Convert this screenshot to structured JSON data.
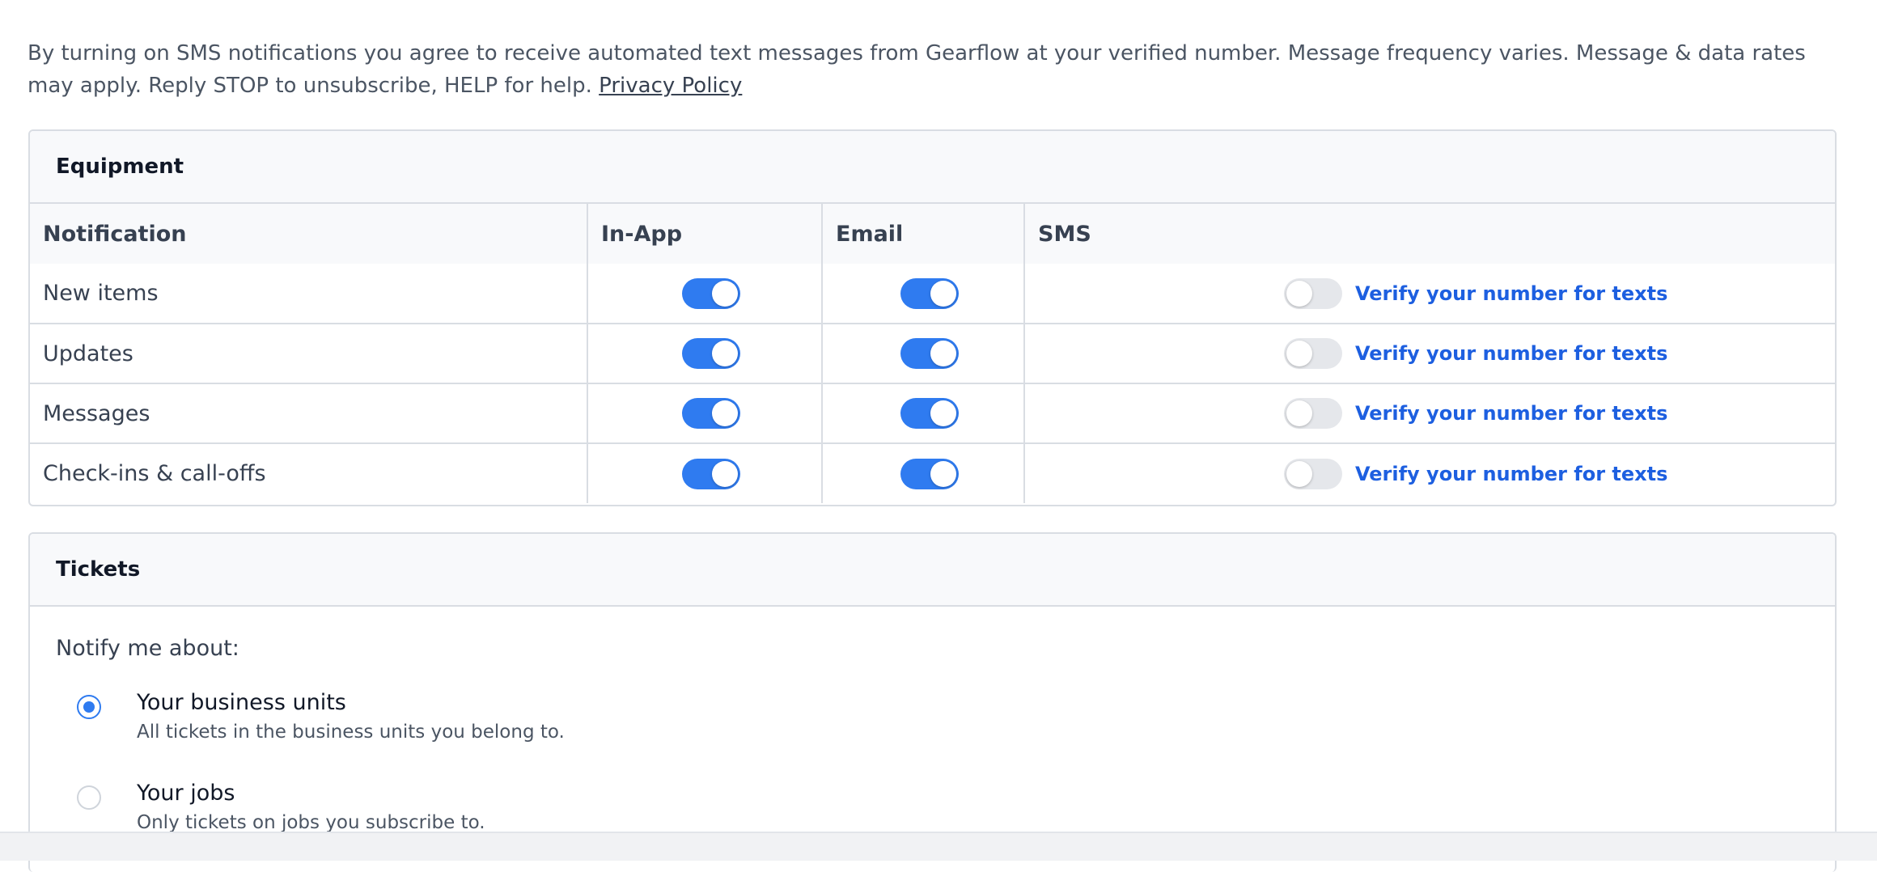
{
  "disclaimer": {
    "text": "By turning on SMS notifications you agree to receive automated text messages from Gearflow at your verified number. Message frequency varies. Message & data rates may apply. Reply STOP to unsubscribe, HELP for help.",
    "privacy_link": "Privacy Policy"
  },
  "equipment": {
    "title": "Equipment",
    "columns": [
      "Notification",
      "In-App",
      "Email",
      "SMS"
    ],
    "rows": [
      {
        "label": "New items",
        "in_app": true,
        "email": true,
        "sms": false,
        "sms_link": "Verify your number for texts"
      },
      {
        "label": "Updates",
        "in_app": true,
        "email": true,
        "sms": false,
        "sms_link": "Verify your number for texts"
      },
      {
        "label": "Messages",
        "in_app": true,
        "email": true,
        "sms": false,
        "sms_link": "Verify your number for texts"
      },
      {
        "label": "Check-ins & call-offs",
        "in_app": true,
        "email": true,
        "sms": false,
        "sms_link": "Verify your number for texts"
      }
    ]
  },
  "tickets": {
    "title": "Tickets",
    "notify_label": "Notify me about:",
    "options": [
      {
        "title": "Your business units",
        "description": "All tickets in the business units you belong to.",
        "selected": true
      },
      {
        "title": "Your jobs",
        "description": "Only tickets on jobs you subscribe to.",
        "selected": false
      }
    ]
  },
  "colors": {
    "accent": "#2f7bf0",
    "link": "#1d5fe0",
    "toggle_off": "#e5e7eb",
    "border": "#d9dde3"
  }
}
